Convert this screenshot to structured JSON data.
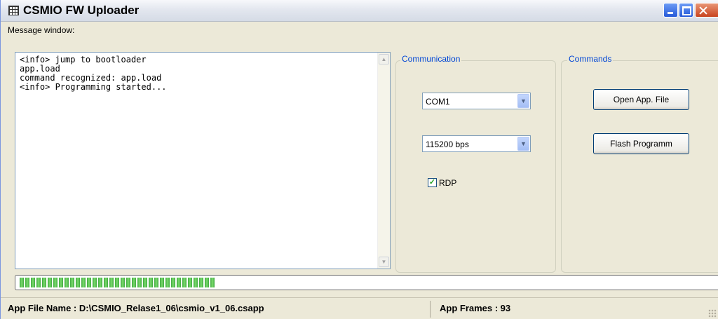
{
  "window": {
    "title": "CSMIO FW Uploader",
    "icon": "grid-icon"
  },
  "message_window": {
    "label": "Message window:",
    "lines": [
      "<info> jump to bootloader",
      "app.load",
      "command recognized: app.load",
      "<info> Programming started..."
    ]
  },
  "communication": {
    "legend": "Communication",
    "port": "COM1",
    "baud": "115200 bps",
    "rdp_label": "RDP",
    "rdp_checked": true
  },
  "commands": {
    "legend": "Commands",
    "open_label": "Open App. File",
    "flash_label": "Flash Programm"
  },
  "progress": {
    "fraction": 0.28,
    "color": "#3ea83e"
  },
  "status": {
    "file_name": "App File Name : D:\\CSMIO_Relase1_06\\csmio_v1_06.csapp",
    "frames": "App Frames : 93"
  }
}
